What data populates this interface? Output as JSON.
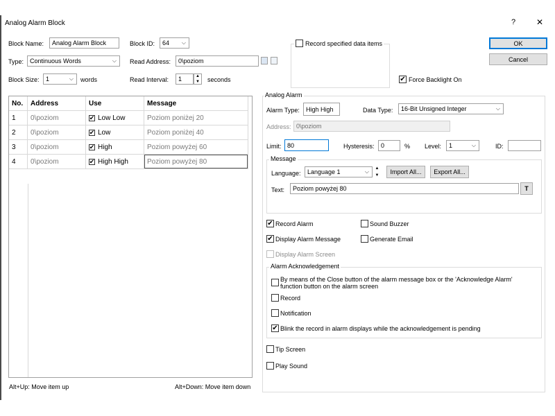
{
  "window": {
    "title": "Analog Alarm Block",
    "help_glyph": "?",
    "close_glyph": "✕"
  },
  "top": {
    "block_name_label": "Block Name:",
    "block_name_value": "Analog Alarm Block",
    "block_id_label": "Block ID:",
    "block_id_value": "64",
    "type_label": "Type:",
    "type_value": "Continuous Words",
    "read_address_label": "Read Address:",
    "read_address_value": "0\\poziom",
    "block_size_label": "Block Size:",
    "block_size_value": "1",
    "block_size_unit": "words",
    "read_interval_label": "Read Interval:",
    "read_interval_value": "1",
    "read_interval_unit": "seconds",
    "record_items_label": "Record specified data items",
    "force_backlight_label": "Force Backlight On",
    "ok_label": "OK",
    "cancel_label": "Cancel"
  },
  "table": {
    "headers": [
      "No.",
      "Address",
      "Use",
      "Message"
    ],
    "rows": [
      {
        "no": "1",
        "address": "0\\poziom",
        "use": "Low Low",
        "message": "Poziom poniżej 20"
      },
      {
        "no": "2",
        "address": "0\\poziom",
        "use": "Low",
        "message": "Poziom poniżej 40"
      },
      {
        "no": "3",
        "address": "0\\poziom",
        "use": "High",
        "message": "Poziom powyżej 60"
      },
      {
        "no": "4",
        "address": "0\\poziom",
        "use": "High High",
        "message": "Poziom powyżej 80"
      }
    ]
  },
  "footer": {
    "move_up": "Alt+Up: Move item up",
    "move_down": "Alt+Down: Move item down"
  },
  "analog_alarm": {
    "group_title": "Analog Alarm",
    "alarm_type_label": "Alarm Type:",
    "alarm_type_value": "High High",
    "data_type_label": "Data Type:",
    "data_type_value": "16-Bit Unsigned Integer",
    "address_label": "Address:",
    "address_value": "0\\poziom",
    "limit_label": "Limit:",
    "limit_value": "80",
    "hysteresis_label": "Hysteresis:",
    "hysteresis_value": "0",
    "hysteresis_unit": "%",
    "level_label": "Level:",
    "level_value": "1",
    "id_label": "ID:",
    "id_value": "",
    "message_group_title": "Message",
    "language_label": "Language:",
    "language_value": "Language 1",
    "import_label": "Import All...",
    "export_label": "Export All...",
    "text_label": "Text:",
    "text_value": "Poziom powyżej 80",
    "text_btn": "T"
  },
  "options": {
    "record_alarm": "Record Alarm",
    "sound_buzzer": "Sound Buzzer",
    "display_alarm_message": "Display Alarm Message",
    "generate_email": "Generate Email",
    "display_alarm_screen": "Display Alarm Screen",
    "ack_group_title": "Alarm Acknowledgement",
    "ack_close_line1": "By means of the Close button of the alarm message box or the 'Acknowledge Alarm'",
    "ack_close_line2": "function button on the alarm screen",
    "ack_record": "Record",
    "ack_notification": "Notification",
    "ack_blink": "Blink the record in alarm displays while the acknowledgement is pending",
    "tip_screen": "Tip Screen",
    "play_sound": "Play Sound"
  },
  "checked": {
    "record_items": false,
    "force_backlight": true,
    "record_alarm": true,
    "sound_buzzer": false,
    "display_alarm_message": true,
    "generate_email": false,
    "display_alarm_screen": false,
    "ack_close": false,
    "ack_record": false,
    "ack_notification": false,
    "ack_blink": true,
    "tip_screen": false,
    "play_sound": false
  },
  "glyphs": {
    "check": "✔",
    "chevron": "⌵",
    "up": "▲",
    "down": "▼"
  },
  "colors": {
    "accent": "#0078d7",
    "border": "#a0a0a0",
    "button": "#e1e1e1"
  }
}
